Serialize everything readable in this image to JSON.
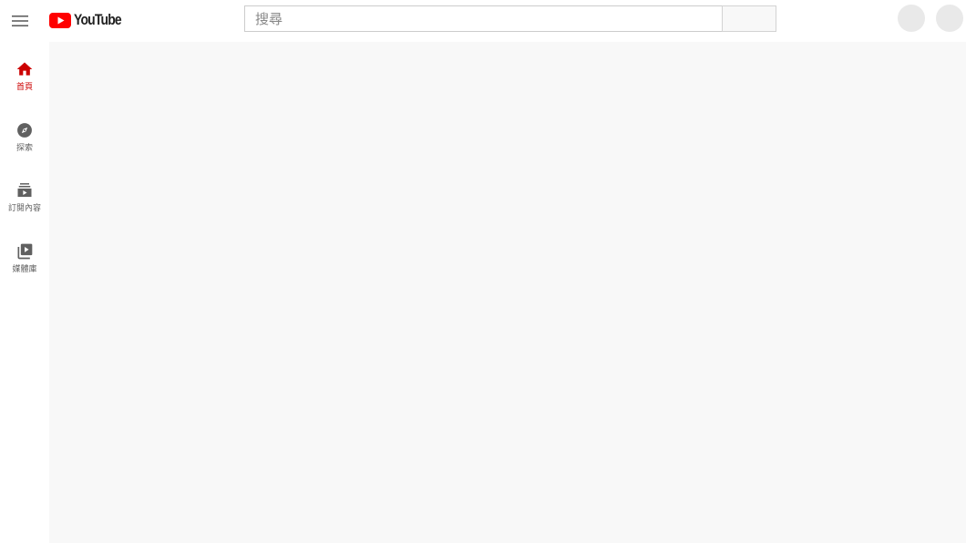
{
  "masthead": {
    "menu_icon": "hamburger-menu-icon",
    "logo_text": "YouTube",
    "search_placeholder": "搜尋",
    "brand_color": "#ff0000"
  },
  "guide": {
    "items": [
      {
        "label": "首頁",
        "icon": "home-icon",
        "active": true
      },
      {
        "label": "探索",
        "icon": "compass-icon",
        "active": false
      },
      {
        "label": "訂閱內容",
        "icon": "subscriptions-icon",
        "active": false
      },
      {
        "label": "媒體庫",
        "icon": "library-icon",
        "active": false
      }
    ],
    "active_color": "#cc0000"
  }
}
